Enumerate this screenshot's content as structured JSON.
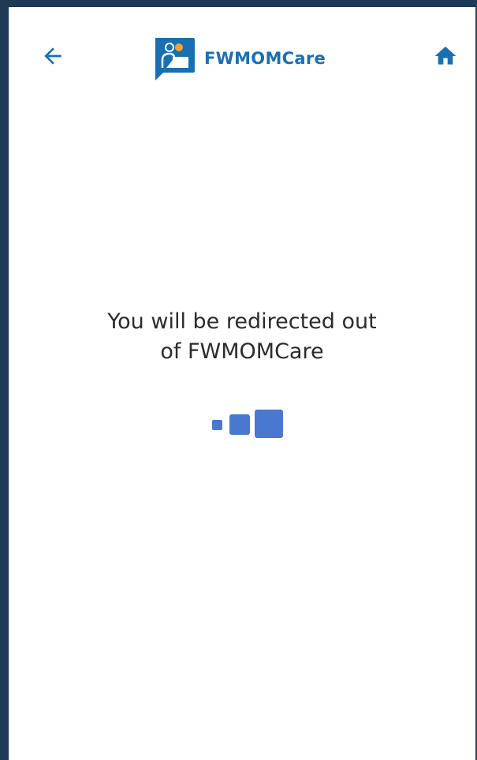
{
  "app": {
    "name": "FWMOMCare"
  },
  "header": {
    "back_icon": "arrow-left-icon",
    "home_icon": "home-icon",
    "logo_icon": "fwmomcare-logo-icon"
  },
  "message": {
    "line1": "You will be redirected out",
    "line2": "of FWMOMCare"
  },
  "loader": {
    "icon": "loading-squares-icon"
  },
  "colors": {
    "frame": "#1e3a56",
    "brand": "#1a6fb3",
    "loader": "#4a78d0",
    "text": "#2b2b2b"
  }
}
